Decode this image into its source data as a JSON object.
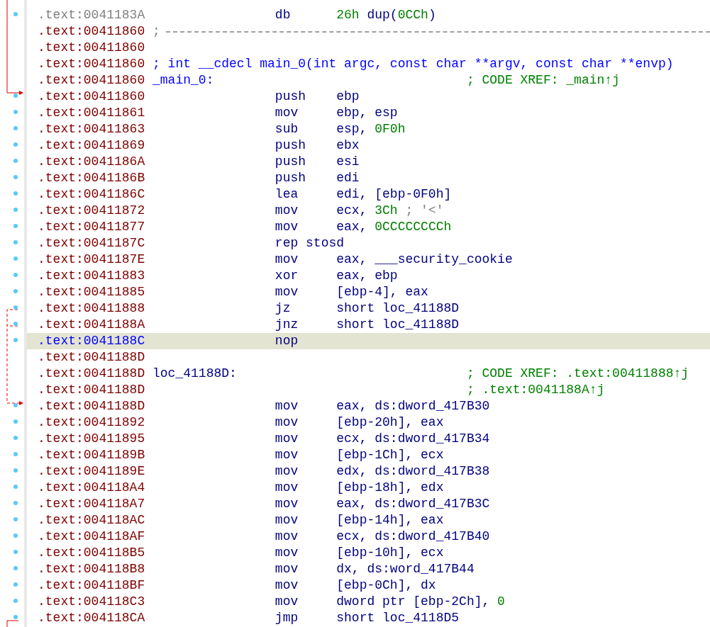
{
  "listing": [
    {
      "address": ".text:0041183A",
      "kind": "data",
      "selected": false,
      "mnemonic": "db",
      "operands": [
        {
          "text": "26h",
          "kind": "number"
        },
        {
          "text": " dup(",
          "kind": "name"
        },
        {
          "text": "0CCh",
          "kind": "number"
        },
        {
          "text": ")",
          "kind": "name"
        }
      ]
    },
    {
      "address": ".text:00411860",
      "kind": "separator",
      "selected": false,
      "comment": ";"
    },
    {
      "address": ".text:00411860",
      "kind": "blank",
      "selected": false
    },
    {
      "address": ".text:00411860",
      "kind": "prototype",
      "selected": false,
      "comment": "; int __cdecl main_0(int argc, const char **argv, const char **envp)"
    },
    {
      "address": ".text:00411860",
      "kind": "function_label",
      "selected": false,
      "label": "_main_0:",
      "comment": "; CODE XREF: _main↑j"
    },
    {
      "address": ".text:00411860",
      "kind": "instruction",
      "selected": false,
      "mnemonic": "push",
      "operands": [
        {
          "text": "ebp",
          "kind": "name"
        }
      ]
    },
    {
      "address": ".text:00411861",
      "kind": "instruction",
      "selected": false,
      "mnemonic": "mov",
      "operands": [
        {
          "text": "ebp, esp",
          "kind": "name"
        }
      ]
    },
    {
      "address": ".text:00411863",
      "kind": "instruction",
      "selected": false,
      "mnemonic": "sub",
      "operands": [
        {
          "text": "esp, ",
          "kind": "name"
        },
        {
          "text": "0F0h",
          "kind": "number"
        }
      ]
    },
    {
      "address": ".text:00411869",
      "kind": "instruction",
      "selected": false,
      "mnemonic": "push",
      "operands": [
        {
          "text": "ebx",
          "kind": "name"
        }
      ]
    },
    {
      "address": ".text:0041186A",
      "kind": "instruction",
      "selected": false,
      "mnemonic": "push",
      "operands": [
        {
          "text": "esi",
          "kind": "name"
        }
      ]
    },
    {
      "address": ".text:0041186B",
      "kind": "instruction",
      "selected": false,
      "mnemonic": "push",
      "operands": [
        {
          "text": "edi",
          "kind": "name"
        }
      ]
    },
    {
      "address": ".text:0041186C",
      "kind": "instruction",
      "selected": false,
      "mnemonic": "lea",
      "operands": [
        {
          "text": "edi, [ebp-0F0h]",
          "kind": "name"
        }
      ]
    },
    {
      "address": ".text:00411872",
      "kind": "instruction",
      "selected": false,
      "mnemonic": "mov",
      "operands": [
        {
          "text": "ecx, ",
          "kind": "name"
        },
        {
          "text": "3Ch",
          "kind": "number"
        },
        {
          "text": " ; '<'",
          "kind": "comment"
        }
      ]
    },
    {
      "address": ".text:00411877",
      "kind": "instruction",
      "selected": false,
      "mnemonic": "mov",
      "operands": [
        {
          "text": "eax, ",
          "kind": "name"
        },
        {
          "text": "0CCCCCCCCh",
          "kind": "number"
        }
      ]
    },
    {
      "address": ".text:0041187C",
      "kind": "instruction",
      "selected": false,
      "mnemonic": "rep stosd"
    },
    {
      "address": ".text:0041187E",
      "kind": "instruction",
      "selected": false,
      "mnemonic": "mov",
      "operands": [
        {
          "text": "eax, ___security_cookie",
          "kind": "name"
        }
      ]
    },
    {
      "address": ".text:00411883",
      "kind": "instruction",
      "selected": false,
      "mnemonic": "xor",
      "operands": [
        {
          "text": "eax, ebp",
          "kind": "name"
        }
      ]
    },
    {
      "address": ".text:00411885",
      "kind": "instruction",
      "selected": false,
      "mnemonic": "mov",
      "operands": [
        {
          "text": "[ebp-4], eax",
          "kind": "name"
        }
      ]
    },
    {
      "address": ".text:00411888",
      "kind": "instruction",
      "selected": false,
      "mnemonic": "jz",
      "operands": [
        {
          "text": "short loc_41188D",
          "kind": "name"
        }
      ]
    },
    {
      "address": ".text:0041188A",
      "kind": "instruction",
      "selected": false,
      "mnemonic": "jnz",
      "operands": [
        {
          "text": "short loc_41188D",
          "kind": "name"
        }
      ]
    },
    {
      "address": ".text:0041188C",
      "kind": "instruction",
      "selected": true,
      "mnemonic": "nop"
    },
    {
      "address": ".text:0041188D",
      "kind": "blank",
      "selected": false
    },
    {
      "address": ".text:0041188D",
      "kind": "label",
      "selected": false,
      "label": "loc_41188D:",
      "comment": "; CODE XREF: .text:00411888↑j"
    },
    {
      "address": ".text:0041188D",
      "kind": "label",
      "selected": false,
      "comment": "; .text:0041188A↑j"
    },
    {
      "address": ".text:0041188D",
      "kind": "instruction",
      "selected": false,
      "mnemonic": "mov",
      "operands": [
        {
          "text": "eax, ds:dword_417B30",
          "kind": "name"
        }
      ]
    },
    {
      "address": ".text:00411892",
      "kind": "instruction",
      "selected": false,
      "mnemonic": "mov",
      "operands": [
        {
          "text": "[ebp-20h], eax",
          "kind": "name"
        }
      ]
    },
    {
      "address": ".text:00411895",
      "kind": "instruction",
      "selected": false,
      "mnemonic": "mov",
      "operands": [
        {
          "text": "ecx, ds:dword_417B34",
          "kind": "name"
        }
      ]
    },
    {
      "address": ".text:0041189B",
      "kind": "instruction",
      "selected": false,
      "mnemonic": "mov",
      "operands": [
        {
          "text": "[ebp-1Ch], ecx",
          "kind": "name"
        }
      ]
    },
    {
      "address": ".text:0041189E",
      "kind": "instruction",
      "selected": false,
      "mnemonic": "mov",
      "operands": [
        {
          "text": "edx, ds:dword_417B38",
          "kind": "name"
        }
      ]
    },
    {
      "address": ".text:004118A4",
      "kind": "instruction",
      "selected": false,
      "mnemonic": "mov",
      "operands": [
        {
          "text": "[ebp-18h], edx",
          "kind": "name"
        }
      ]
    },
    {
      "address": ".text:004118A7",
      "kind": "instruction",
      "selected": false,
      "mnemonic": "mov",
      "operands": [
        {
          "text": "eax, ds:dword_417B3C",
          "kind": "name"
        }
      ]
    },
    {
      "address": ".text:004118AC",
      "kind": "instruction",
      "selected": false,
      "mnemonic": "mov",
      "operands": [
        {
          "text": "[ebp-14h], eax",
          "kind": "name"
        }
      ]
    },
    {
      "address": ".text:004118AF",
      "kind": "instruction",
      "selected": false,
      "mnemonic": "mov",
      "operands": [
        {
          "text": "ecx, ds:dword_417B40",
          "kind": "name"
        }
      ]
    },
    {
      "address": ".text:004118B5",
      "kind": "instruction",
      "selected": false,
      "mnemonic": "mov",
      "operands": [
        {
          "text": "[ebp-10h], ecx",
          "kind": "name"
        }
      ]
    },
    {
      "address": ".text:004118B8",
      "kind": "instruction",
      "selected": false,
      "mnemonic": "mov",
      "operands": [
        {
          "text": "dx, ds:word_417B44",
          "kind": "name"
        }
      ]
    },
    {
      "address": ".text:004118BF",
      "kind": "instruction",
      "selected": false,
      "mnemonic": "mov",
      "operands": [
        {
          "text": "[ebp-0Ch], dx",
          "kind": "name"
        }
      ]
    },
    {
      "address": ".text:004118C3",
      "kind": "instruction",
      "selected": false,
      "mnemonic": "mov",
      "operands": [
        {
          "text": "dword ptr [ebp-2Ch], ",
          "kind": "name"
        },
        {
          "text": "0",
          "kind": "number"
        }
      ]
    },
    {
      "address": ".text:004118CA",
      "kind": "instruction",
      "selected": false,
      "mnemonic": "jmp",
      "operands": [
        {
          "text": "short loc_4118D5",
          "kind": "name"
        }
      ]
    }
  ]
}
